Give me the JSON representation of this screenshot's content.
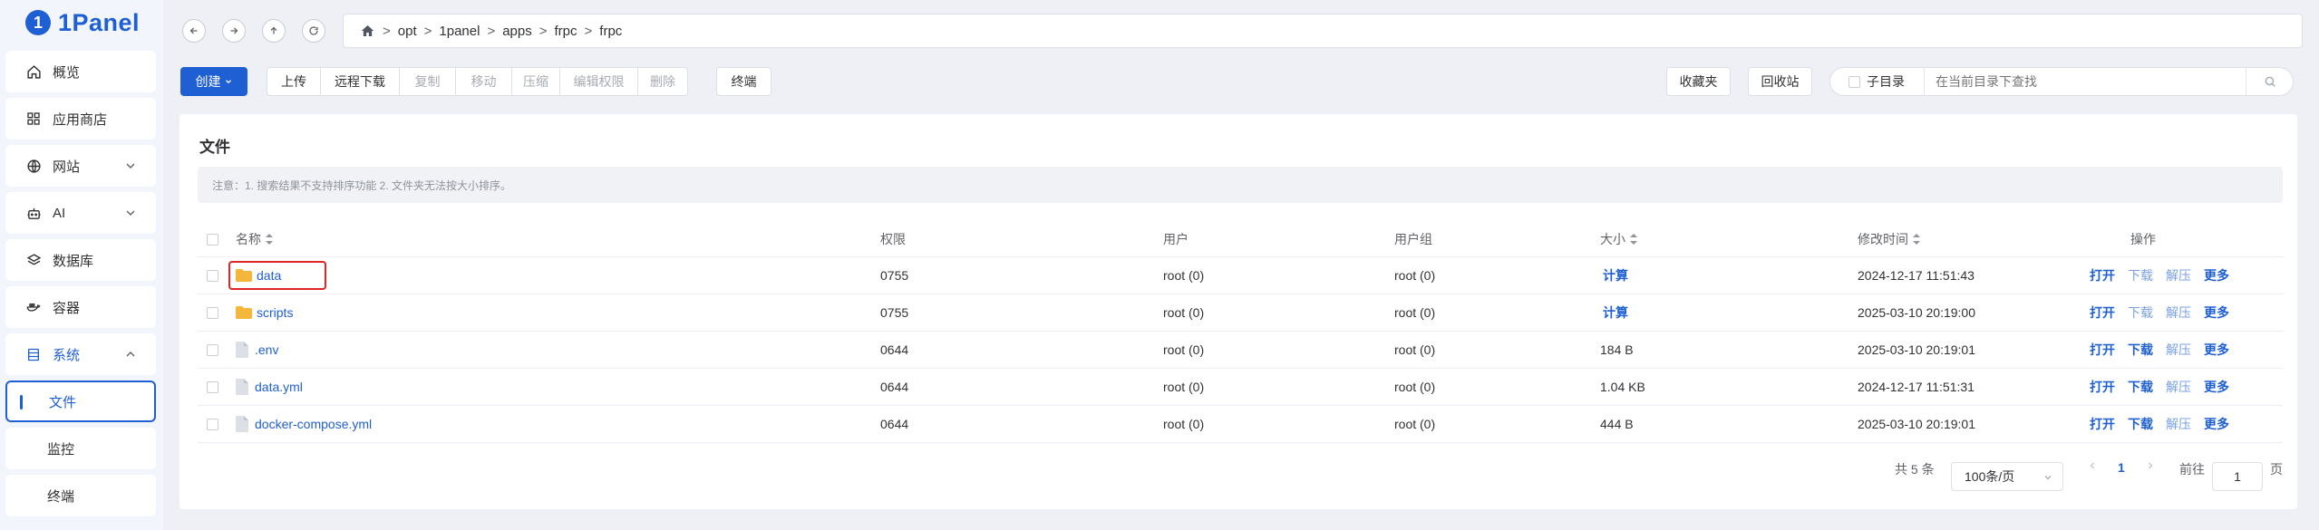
{
  "app": {
    "name": "1Panel",
    "accent": "#1f5fd4",
    "highlight_color": "#e02424"
  },
  "sidebar": {
    "items": [
      {
        "label": "概览",
        "icon": "home-icon"
      },
      {
        "label": "应用商店",
        "icon": "grid-icon"
      },
      {
        "label": "网站",
        "icon": "globe-icon",
        "expandable": true
      },
      {
        "label": "AI",
        "icon": "robot-icon",
        "expandable": true
      },
      {
        "label": "数据库",
        "icon": "layers-icon"
      },
      {
        "label": "容器",
        "icon": "docker-icon"
      },
      {
        "label": "系统",
        "icon": "server-icon",
        "expanded": true
      }
    ],
    "subitems": [
      {
        "label": "文件",
        "active": true
      },
      {
        "label": "监控"
      },
      {
        "label": "终端"
      }
    ]
  },
  "path": {
    "segments": [
      "opt",
      "1panel",
      "apps",
      "frpc",
      "frpc"
    ],
    "separator": ">"
  },
  "toolbar": {
    "create_label": "创建",
    "upload_label": "上传",
    "remote_download_label": "远程下载",
    "copy_label": "复制",
    "move_label": "移动",
    "compress_label": "压缩",
    "edit_perm_label": "编辑权限",
    "delete_label": "删除",
    "terminal_label": "终端",
    "favorites_label": "收藏夹",
    "recycle_label": "回收站",
    "subdir_label": "子目录",
    "search_placeholder": "在当前目录下查找"
  },
  "card": {
    "title": "文件",
    "notice": "注意：1. 搜索结果不支持排序功能 2. 文件夹无法按大小排序。"
  },
  "table": {
    "headers": {
      "name": "名称",
      "perm": "权限",
      "user": "用户",
      "group": "用户组",
      "size": "大小",
      "mtime": "修改时间",
      "actions": "操作"
    },
    "rows": [
      {
        "name": "data",
        "type": "folder",
        "perm": "0755",
        "user": "root (0)",
        "group": "root (0)",
        "size": "计算",
        "size_is_action": true,
        "mtime": "2024-12-17 11:51:43"
      },
      {
        "name": "scripts",
        "type": "folder",
        "perm": "0755",
        "user": "root (0)",
        "group": "root (0)",
        "size": "计算",
        "size_is_action": true,
        "mtime": "2025-03-10 20:19:00"
      },
      {
        "name": ".env",
        "type": "file",
        "perm": "0644",
        "user": "root (0)",
        "group": "root (0)",
        "size": "184 B",
        "mtime": "2025-03-10 20:19:01"
      },
      {
        "name": "data.yml",
        "type": "file",
        "perm": "0644",
        "user": "root (0)",
        "group": "root (0)",
        "size": "1.04 KB",
        "mtime": "2024-12-17 11:51:31"
      },
      {
        "name": "docker-compose.yml",
        "type": "file",
        "perm": "0644",
        "user": "root (0)",
        "group": "root (0)",
        "size": "444 B",
        "mtime": "2025-03-10 20:19:01"
      }
    ],
    "actions": {
      "open": "打开",
      "download": "下载",
      "unzip": "解压",
      "more": "更多"
    }
  },
  "pagination": {
    "total_label": "共 5 条",
    "page_size_label": "100条/页",
    "current_page": "1",
    "goto_label": "前往",
    "goto_value": "1",
    "page_suffix": "页"
  }
}
